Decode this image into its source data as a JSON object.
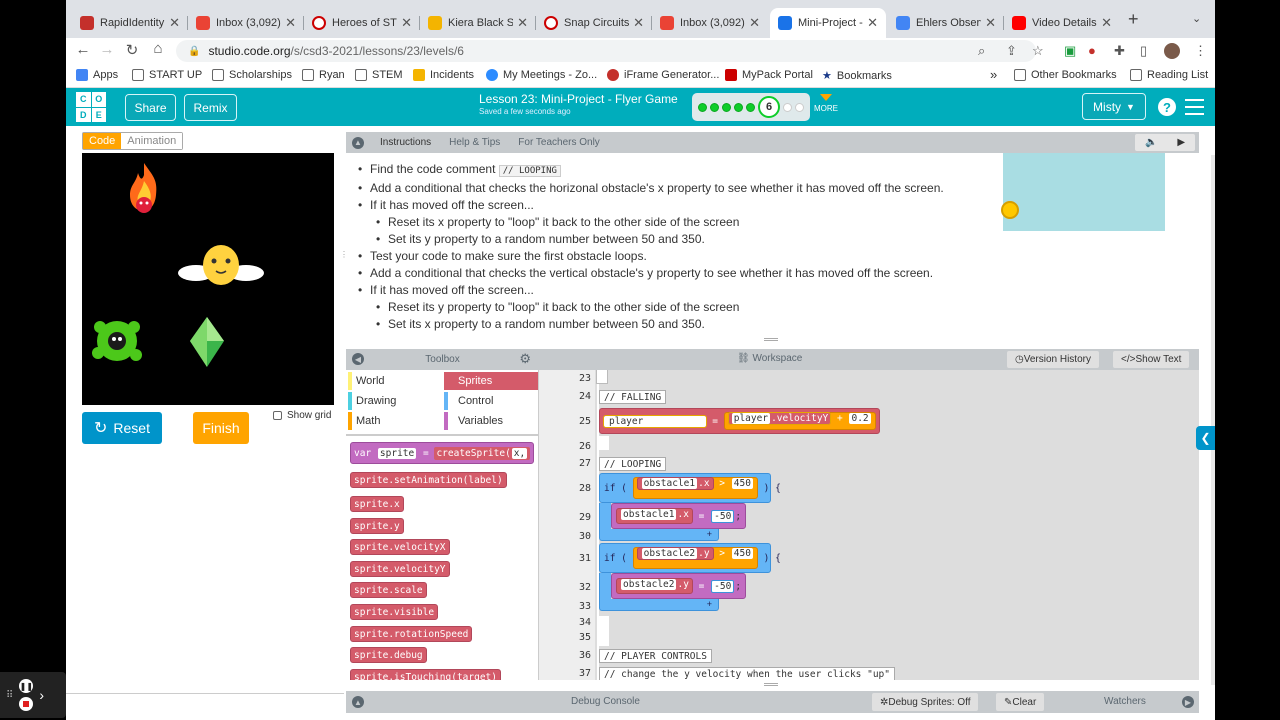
{
  "tabs": [
    {
      "label": "RapidIdentity",
      "color": "#c4302b"
    },
    {
      "label": "Inbox (3,092)",
      "color": "#ea4335"
    },
    {
      "label": "Heroes of STE",
      "color": "#cc0000"
    },
    {
      "label": "Kiera Black ST",
      "color": "#f4b400"
    },
    {
      "label": "Snap Circuits",
      "color": "#cc0000"
    },
    {
      "label": "Inbox (3,092)",
      "color": "#ea4335"
    },
    {
      "label": "Mini-Project -",
      "color": "#1a73e8"
    },
    {
      "label": "Ehlers Observ",
      "color": "#4285f4"
    },
    {
      "label": "Video Details",
      "color": "#ff0000"
    }
  ],
  "address": {
    "host": "studio.code.org",
    "path": "/s/csd3-2021/lessons/23/levels/6"
  },
  "bookmarks": [
    "Apps",
    "START UP",
    "Scholarships",
    "Ryan",
    "STEM",
    "Incidents",
    "My Meetings - Zo...",
    "iFrame Generator...",
    "MyPack Portal",
    "Bookmarks",
    "Other Bookmarks",
    "Reading List"
  ],
  "header": {
    "share": "Share",
    "remix": "Remix",
    "lesson_title": "Lesson 23: Mini-Project - Flyer Game",
    "saved": "Saved a few seconds ago",
    "level": "6",
    "more": "MORE",
    "user": "Misty",
    "help": "?"
  },
  "left": {
    "code_tab": "Code",
    "animation_tab": "Animation",
    "reset": "Reset",
    "finish": "Finish",
    "show_grid": "Show grid"
  },
  "instructions": {
    "tabs": [
      "Instructions",
      "Help & Tips",
      "For Teachers Only"
    ],
    "items": [
      {
        "text": "Find the code comment ",
        "code": "// LOOPING",
        "sub": false
      },
      {
        "text": "Add a conditional that checks the horizonal obstacle's x property to see whether it has moved off the screen.",
        "sub": false
      },
      {
        "text": "If it has moved off the screen...",
        "sub": false
      },
      {
        "text": "Reset its x property to \"loop\" it back to the other side of the screen",
        "sub": true
      },
      {
        "text": "Set its y property to a random number between 50 and 350.",
        "sub": true
      },
      {
        "text": "Test your code to make sure the first obstacle loops.",
        "sub": false
      },
      {
        "text": "Add a conditional that checks the vertical obstacle's y property to see whether it has moved off the screen.",
        "sub": false
      },
      {
        "text": "If it has moved off the screen...",
        "sub": false
      },
      {
        "text": "Reset its y property to \"loop\" it back to the other side of the screen",
        "sub": true
      },
      {
        "text": "Set its x property to a random number between 50 and 350.",
        "sub": true
      }
    ]
  },
  "toolbox": {
    "title": "Toolbox",
    "categories": [
      {
        "label": "World",
        "color": "#fff176"
      },
      {
        "label": "Sprites",
        "color": "#d45b6a"
      },
      {
        "label": "Drawing",
        "color": "#4dd0e1"
      },
      {
        "label": "Control",
        "color": "#64b5f6"
      },
      {
        "label": "Math",
        "color": "#ffa400"
      },
      {
        "label": "Variables",
        "color": "#c26bc1"
      }
    ],
    "blocks": [
      "sprite.setAnimation(label)",
      "sprite.x",
      "sprite.y",
      "sprite.velocityX",
      "sprite.velocityY",
      "sprite.scale",
      "sprite.visible",
      "sprite.rotationSpeed",
      "sprite.debug",
      "sprite.isTouching(target)"
    ],
    "var_block": {
      "kw": "var",
      "name": "sprite",
      "eq": "=",
      "fn": "createSprite(",
      "arg": "x,"
    }
  },
  "workspace": {
    "title": "Workspace",
    "version_history": "Version History",
    "show_text": "Show Text",
    "line_numbers": [
      "23",
      "24",
      "25",
      "26",
      "27",
      "28",
      "29",
      "30",
      "31",
      "32",
      "33",
      "34",
      "35",
      "36",
      "37"
    ],
    "falling": "// FALLING",
    "looping": "// LOOPING",
    "player_controls": "// PLAYER CONTROLS",
    "comment37": "// change the y velocity when the user clicks \"up\"",
    "line25": {
      "a": "player",
      "b": ".velocityY",
      "eq": "=",
      "c": "player",
      "d": ".velocityY",
      "op": "+",
      "v": "0.2"
    },
    "line28": {
      "kw": "if",
      "obj": "obstacle1",
      "prop": ".x",
      "op": ">",
      "v": "450"
    },
    "line29": {
      "obj": "obstacle1",
      "prop": ".x",
      "eq": "=",
      "v": "-50"
    },
    "line31": {
      "kw": "if",
      "obj": "obstacle2",
      "prop": ".y",
      "op": ">",
      "v": "450"
    },
    "line32": {
      "obj": "obstacle2",
      "prop": ".y",
      "eq": "=",
      "v": "-50"
    }
  },
  "debug": {
    "title": "Debug Console",
    "sprites": "Debug Sprites: Off",
    "clear": "Clear",
    "watchers": "Watchers"
  }
}
